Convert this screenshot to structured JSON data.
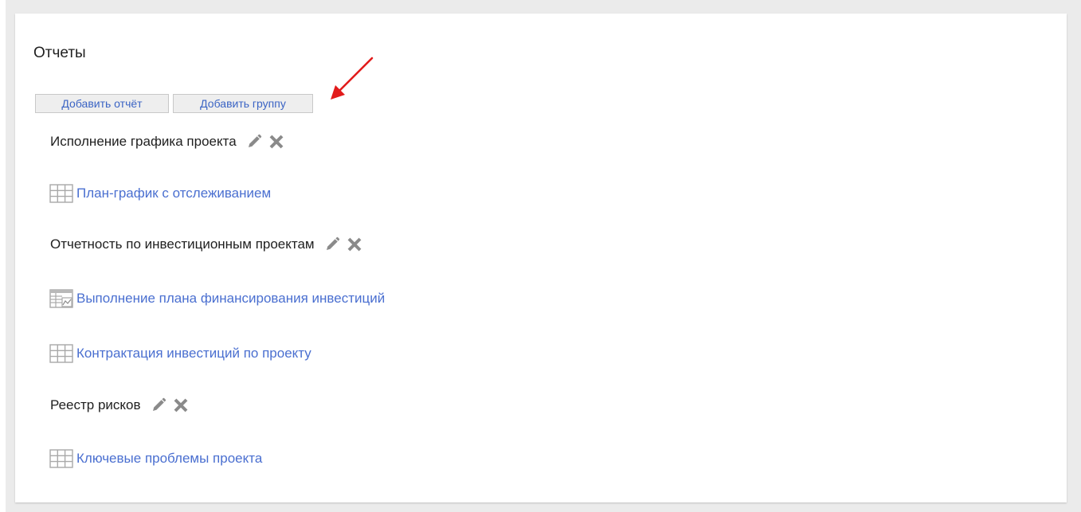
{
  "panel": {
    "title": "Отчеты"
  },
  "toolbar": {
    "add_report_label": "Добавить отчёт",
    "add_group_label": "Добавить группу"
  },
  "groups": [
    {
      "label": "Исполнение графика проекта",
      "reports": [
        {
          "label": "План-график с отслеживанием",
          "icon": "table-icon"
        }
      ]
    },
    {
      "label": "Отчетность по инвестиционным проектам",
      "reports": [
        {
          "label": "Выполнение плана финансирования инвестиций",
          "icon": "table-chart-icon"
        },
        {
          "label": "Контрактация инвестиций по проекту",
          "icon": "table-icon"
        }
      ]
    },
    {
      "label": "Реестр рисков",
      "reports": [
        {
          "label": "Ключевые проблемы проекта",
          "icon": "table-icon"
        }
      ]
    }
  ],
  "colors": {
    "link": "#4a6fd0",
    "button_text": "#3b64c4",
    "action_icon": "#8a8a8a",
    "annotation_arrow": "#e21b1b"
  }
}
